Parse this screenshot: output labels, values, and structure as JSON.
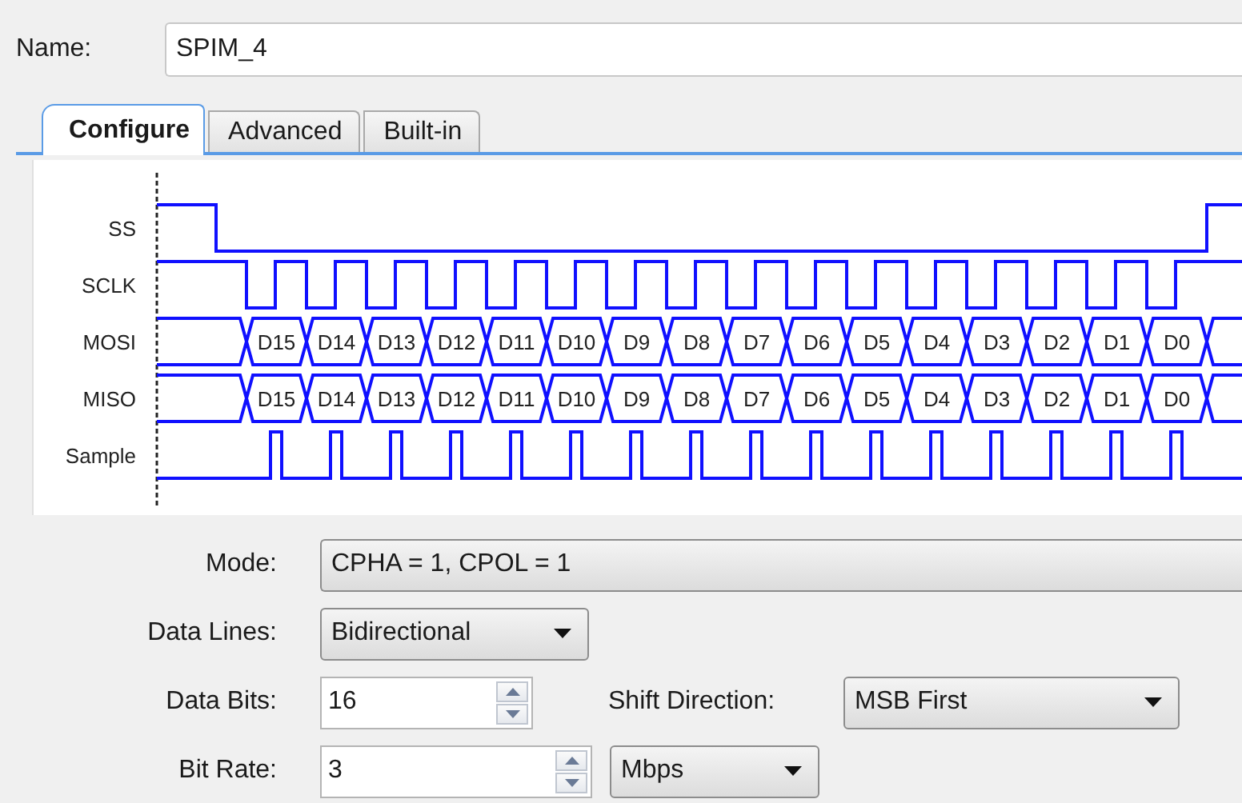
{
  "name_field": {
    "label": "Name:",
    "value": "SPIM_4"
  },
  "tabs": [
    {
      "label": "Configure",
      "selected": true
    },
    {
      "label": "Advanced",
      "selected": false
    },
    {
      "label": "Built-in",
      "selected": false
    }
  ],
  "timing_diagram": {
    "signals": [
      {
        "name": "SS",
        "kind": "select"
      },
      {
        "name": "SCLK",
        "kind": "clock"
      },
      {
        "name": "MOSI",
        "kind": "bus",
        "bits": [
          "D15",
          "D14",
          "D13",
          "D12",
          "D11",
          "D10",
          "D9",
          "D8",
          "D7",
          "D6",
          "D5",
          "D4",
          "D3",
          "D2",
          "D1",
          "D0"
        ]
      },
      {
        "name": "MISO",
        "kind": "bus",
        "bits": [
          "D15",
          "D14",
          "D13",
          "D12",
          "D11",
          "D10",
          "D9",
          "D8",
          "D7",
          "D6",
          "D5",
          "D4",
          "D3",
          "D2",
          "D1",
          "D0"
        ]
      },
      {
        "name": "Sample",
        "kind": "pulse"
      }
    ]
  },
  "settings": [
    {
      "fields": [
        {
          "label": "Mode:",
          "kind": "wide",
          "value": "CPHA = 1, CPOL = 1"
        }
      ]
    },
    {
      "fields": [
        {
          "label": "Data Lines:",
          "kind": "dropdown",
          "value": "Bidirectional"
        }
      ]
    },
    {
      "fields": [
        {
          "label": "Data Bits:",
          "kind": "spin",
          "value": "16"
        },
        {
          "label": "Shift Direction:",
          "kind": "dropdown",
          "value": "MSB First"
        }
      ]
    },
    {
      "fields": [
        {
          "label": "Bit Rate:",
          "kind": "spin",
          "value": "3"
        },
        {
          "kind": "dropdown",
          "value": "Mbps"
        }
      ]
    }
  ]
}
